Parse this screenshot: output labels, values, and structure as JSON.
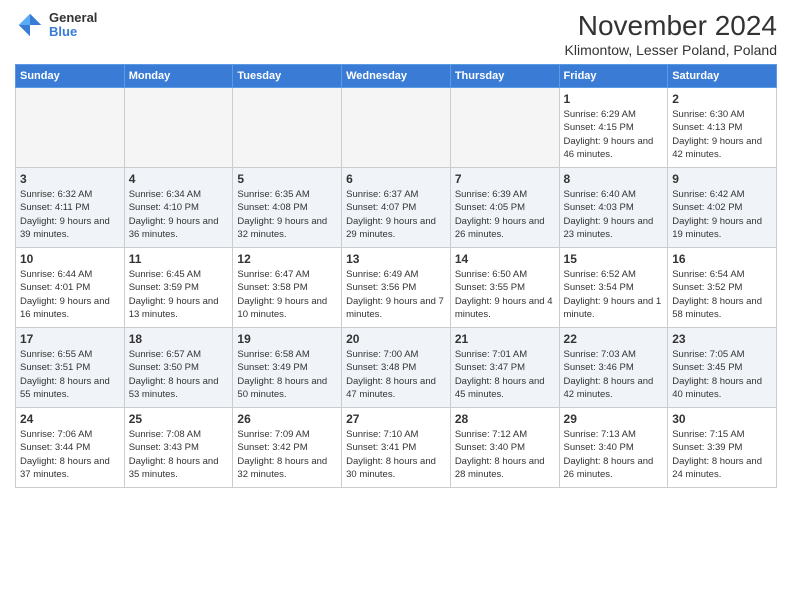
{
  "header": {
    "logo_general": "General",
    "logo_blue": "Blue",
    "month_title": "November 2024",
    "location": "Klimontow, Lesser Poland, Poland"
  },
  "weekdays": [
    "Sunday",
    "Monday",
    "Tuesday",
    "Wednesday",
    "Thursday",
    "Friday",
    "Saturday"
  ],
  "weeks": [
    [
      {
        "day": "",
        "info": ""
      },
      {
        "day": "",
        "info": ""
      },
      {
        "day": "",
        "info": ""
      },
      {
        "day": "",
        "info": ""
      },
      {
        "day": "",
        "info": ""
      },
      {
        "day": "1",
        "info": "Sunrise: 6:29 AM\nSunset: 4:15 PM\nDaylight: 9 hours and 46 minutes."
      },
      {
        "day": "2",
        "info": "Sunrise: 6:30 AM\nSunset: 4:13 PM\nDaylight: 9 hours and 42 minutes."
      }
    ],
    [
      {
        "day": "3",
        "info": "Sunrise: 6:32 AM\nSunset: 4:11 PM\nDaylight: 9 hours and 39 minutes."
      },
      {
        "day": "4",
        "info": "Sunrise: 6:34 AM\nSunset: 4:10 PM\nDaylight: 9 hours and 36 minutes."
      },
      {
        "day": "5",
        "info": "Sunrise: 6:35 AM\nSunset: 4:08 PM\nDaylight: 9 hours and 32 minutes."
      },
      {
        "day": "6",
        "info": "Sunrise: 6:37 AM\nSunset: 4:07 PM\nDaylight: 9 hours and 29 minutes."
      },
      {
        "day": "7",
        "info": "Sunrise: 6:39 AM\nSunset: 4:05 PM\nDaylight: 9 hours and 26 minutes."
      },
      {
        "day": "8",
        "info": "Sunrise: 6:40 AM\nSunset: 4:03 PM\nDaylight: 9 hours and 23 minutes."
      },
      {
        "day": "9",
        "info": "Sunrise: 6:42 AM\nSunset: 4:02 PM\nDaylight: 9 hours and 19 minutes."
      }
    ],
    [
      {
        "day": "10",
        "info": "Sunrise: 6:44 AM\nSunset: 4:01 PM\nDaylight: 9 hours and 16 minutes."
      },
      {
        "day": "11",
        "info": "Sunrise: 6:45 AM\nSunset: 3:59 PM\nDaylight: 9 hours and 13 minutes."
      },
      {
        "day": "12",
        "info": "Sunrise: 6:47 AM\nSunset: 3:58 PM\nDaylight: 9 hours and 10 minutes."
      },
      {
        "day": "13",
        "info": "Sunrise: 6:49 AM\nSunset: 3:56 PM\nDaylight: 9 hours and 7 minutes."
      },
      {
        "day": "14",
        "info": "Sunrise: 6:50 AM\nSunset: 3:55 PM\nDaylight: 9 hours and 4 minutes."
      },
      {
        "day": "15",
        "info": "Sunrise: 6:52 AM\nSunset: 3:54 PM\nDaylight: 9 hours and 1 minute."
      },
      {
        "day": "16",
        "info": "Sunrise: 6:54 AM\nSunset: 3:52 PM\nDaylight: 8 hours and 58 minutes."
      }
    ],
    [
      {
        "day": "17",
        "info": "Sunrise: 6:55 AM\nSunset: 3:51 PM\nDaylight: 8 hours and 55 minutes."
      },
      {
        "day": "18",
        "info": "Sunrise: 6:57 AM\nSunset: 3:50 PM\nDaylight: 8 hours and 53 minutes."
      },
      {
        "day": "19",
        "info": "Sunrise: 6:58 AM\nSunset: 3:49 PM\nDaylight: 8 hours and 50 minutes."
      },
      {
        "day": "20",
        "info": "Sunrise: 7:00 AM\nSunset: 3:48 PM\nDaylight: 8 hours and 47 minutes."
      },
      {
        "day": "21",
        "info": "Sunrise: 7:01 AM\nSunset: 3:47 PM\nDaylight: 8 hours and 45 minutes."
      },
      {
        "day": "22",
        "info": "Sunrise: 7:03 AM\nSunset: 3:46 PM\nDaylight: 8 hours and 42 minutes."
      },
      {
        "day": "23",
        "info": "Sunrise: 7:05 AM\nSunset: 3:45 PM\nDaylight: 8 hours and 40 minutes."
      }
    ],
    [
      {
        "day": "24",
        "info": "Sunrise: 7:06 AM\nSunset: 3:44 PM\nDaylight: 8 hours and 37 minutes."
      },
      {
        "day": "25",
        "info": "Sunrise: 7:08 AM\nSunset: 3:43 PM\nDaylight: 8 hours and 35 minutes."
      },
      {
        "day": "26",
        "info": "Sunrise: 7:09 AM\nSunset: 3:42 PM\nDaylight: 8 hours and 32 minutes."
      },
      {
        "day": "27",
        "info": "Sunrise: 7:10 AM\nSunset: 3:41 PM\nDaylight: 8 hours and 30 minutes."
      },
      {
        "day": "28",
        "info": "Sunrise: 7:12 AM\nSunset: 3:40 PM\nDaylight: 8 hours and 28 minutes."
      },
      {
        "day": "29",
        "info": "Sunrise: 7:13 AM\nSunset: 3:40 PM\nDaylight: 8 hours and 26 minutes."
      },
      {
        "day": "30",
        "info": "Sunrise: 7:15 AM\nSunset: 3:39 PM\nDaylight: 8 hours and 24 minutes."
      }
    ]
  ]
}
